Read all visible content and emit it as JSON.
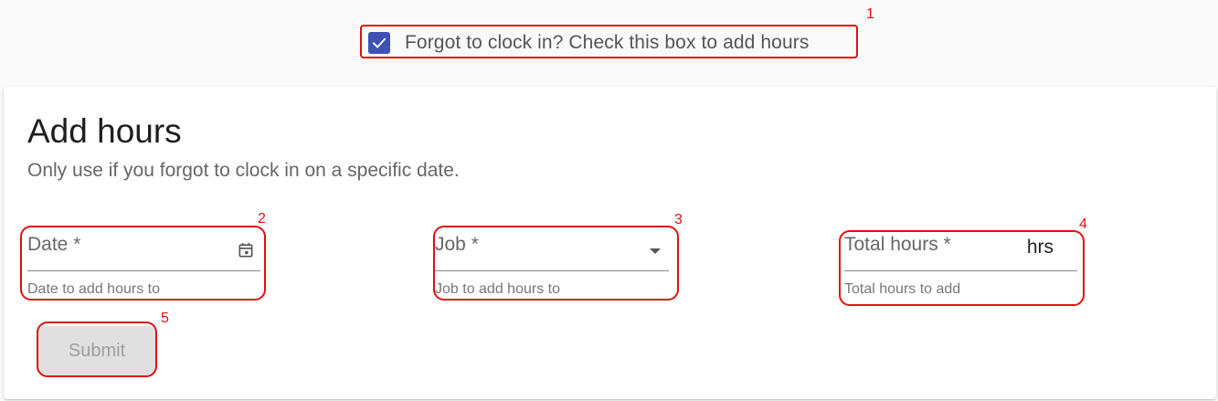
{
  "forgot_checkbox": {
    "checked": true,
    "label": "Forgot to clock in? Check this box to add hours"
  },
  "card": {
    "title": "Add hours",
    "subtitle": "Only use if you forgot to clock in on a specific date."
  },
  "fields": {
    "date": {
      "label": "Date *",
      "hint": "Date to add hours to",
      "icon": "calendar-icon"
    },
    "job": {
      "label": "Job *",
      "hint": "Job to add hours to",
      "icon": "dropdown-arrow-icon"
    },
    "hours": {
      "label": "Total hours *",
      "suffix": "hrs",
      "hint": "Total hours to add"
    }
  },
  "submit": {
    "label": "Submit",
    "disabled": true
  },
  "annotations": [
    "1",
    "2",
    "3",
    "4",
    "5"
  ],
  "colors": {
    "accent": "#3f51b5",
    "annotation": "#e01010",
    "disabled_button": "#e0e0e0"
  }
}
